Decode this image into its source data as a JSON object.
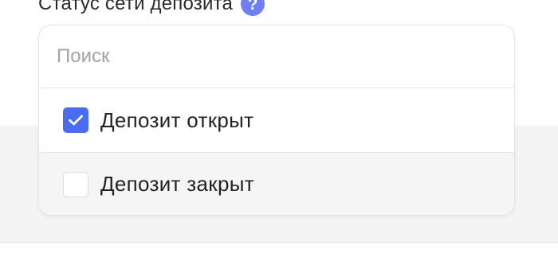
{
  "field": {
    "label": "Статус сети депозита",
    "help_icon": "question-mark-icon",
    "help_glyph": "?"
  },
  "dropdown": {
    "search": {
      "placeholder": "Поиск",
      "value": ""
    },
    "options": [
      {
        "label": "Депозит открыт",
        "checked": true
      },
      {
        "label": "Депозит закрыт",
        "checked": false
      }
    ]
  },
  "colors": {
    "accent": "#4a6cf0",
    "help_icon": "#6e7ff3",
    "placeholder": "#a3a3a3",
    "hover_row": "#f5f5f5",
    "background_band": "#f4f4f4"
  }
}
